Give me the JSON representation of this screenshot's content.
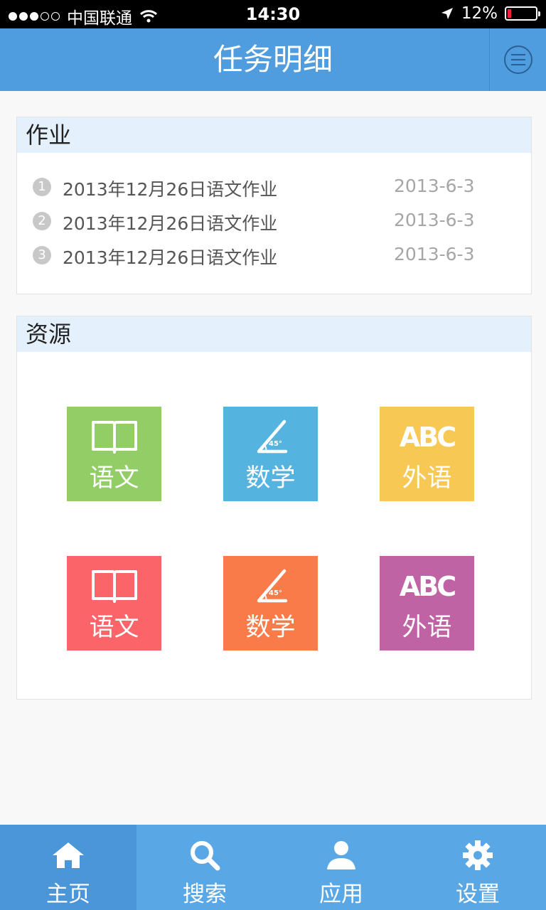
{
  "status_bar": {
    "carrier": "中国联通",
    "time": "14:30",
    "battery": "12%"
  },
  "header": {
    "title": "任务明细"
  },
  "homework": {
    "section_title": "作业",
    "items": [
      {
        "num": "1",
        "title": "2013年12月26日语文作业",
        "date": "2013-6-3"
      },
      {
        "num": "2",
        "title": "2013年12月26日语文作业",
        "date": "2013-6-3"
      },
      {
        "num": "3",
        "title": "2013年12月26日语文作业",
        "date": "2013-6-3"
      }
    ]
  },
  "resources": {
    "section_title": "资源",
    "tiles": [
      {
        "label": "语文",
        "icon": "book-icon",
        "color": "#92cd66"
      },
      {
        "label": "数学",
        "icon": "ruler-angle-icon",
        "color": "#55b3e0"
      },
      {
        "label": "外语",
        "icon": "abc-icon",
        "color": "#f8c855"
      },
      {
        "label": "语文",
        "icon": "book-icon",
        "color": "#fb6468"
      },
      {
        "label": "数学",
        "icon": "ruler-angle-icon",
        "color": "#f97b4a"
      },
      {
        "label": "外语",
        "icon": "abc-icon",
        "color": "#c063a4"
      }
    ],
    "angle_text": "45°",
    "abc_text": "ABC"
  },
  "tabbar": {
    "tabs": [
      {
        "label": "主页",
        "icon": "home-icon",
        "active": true
      },
      {
        "label": "搜索",
        "icon": "search-icon",
        "active": false
      },
      {
        "label": "应用",
        "icon": "user-icon",
        "active": false
      },
      {
        "label": "设置",
        "icon": "gear-icon",
        "active": false
      }
    ]
  },
  "colors": {
    "header": "#4f9ddf",
    "tabbar": "#5aa7e6",
    "section_header": "#e4f0fc"
  }
}
